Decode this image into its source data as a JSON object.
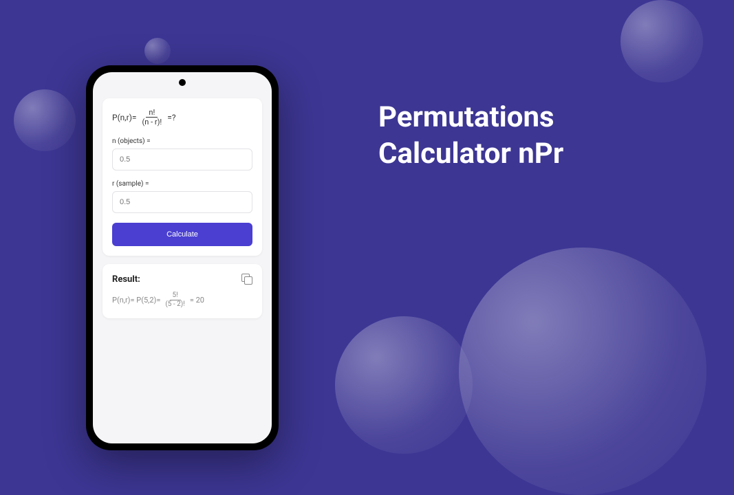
{
  "title": {
    "line1": "Permutations",
    "line2": "Calculator nPr"
  },
  "formula": {
    "lhs": "P(n,r)=",
    "numerator": "n!",
    "denominator": "(n - r)!",
    "rhs": "=?"
  },
  "fields": {
    "n_label": "n (objects) =",
    "n_placeholder": "0.5",
    "r_label": "r (sample) =",
    "r_placeholder": "0.5"
  },
  "button": {
    "calculate": "Calculate"
  },
  "result": {
    "heading": "Result:",
    "prefix": "P(n,r)= P(5,2)=",
    "numerator": "5!",
    "denominator": "(5 - 2)!",
    "suffix": "= 20"
  }
}
